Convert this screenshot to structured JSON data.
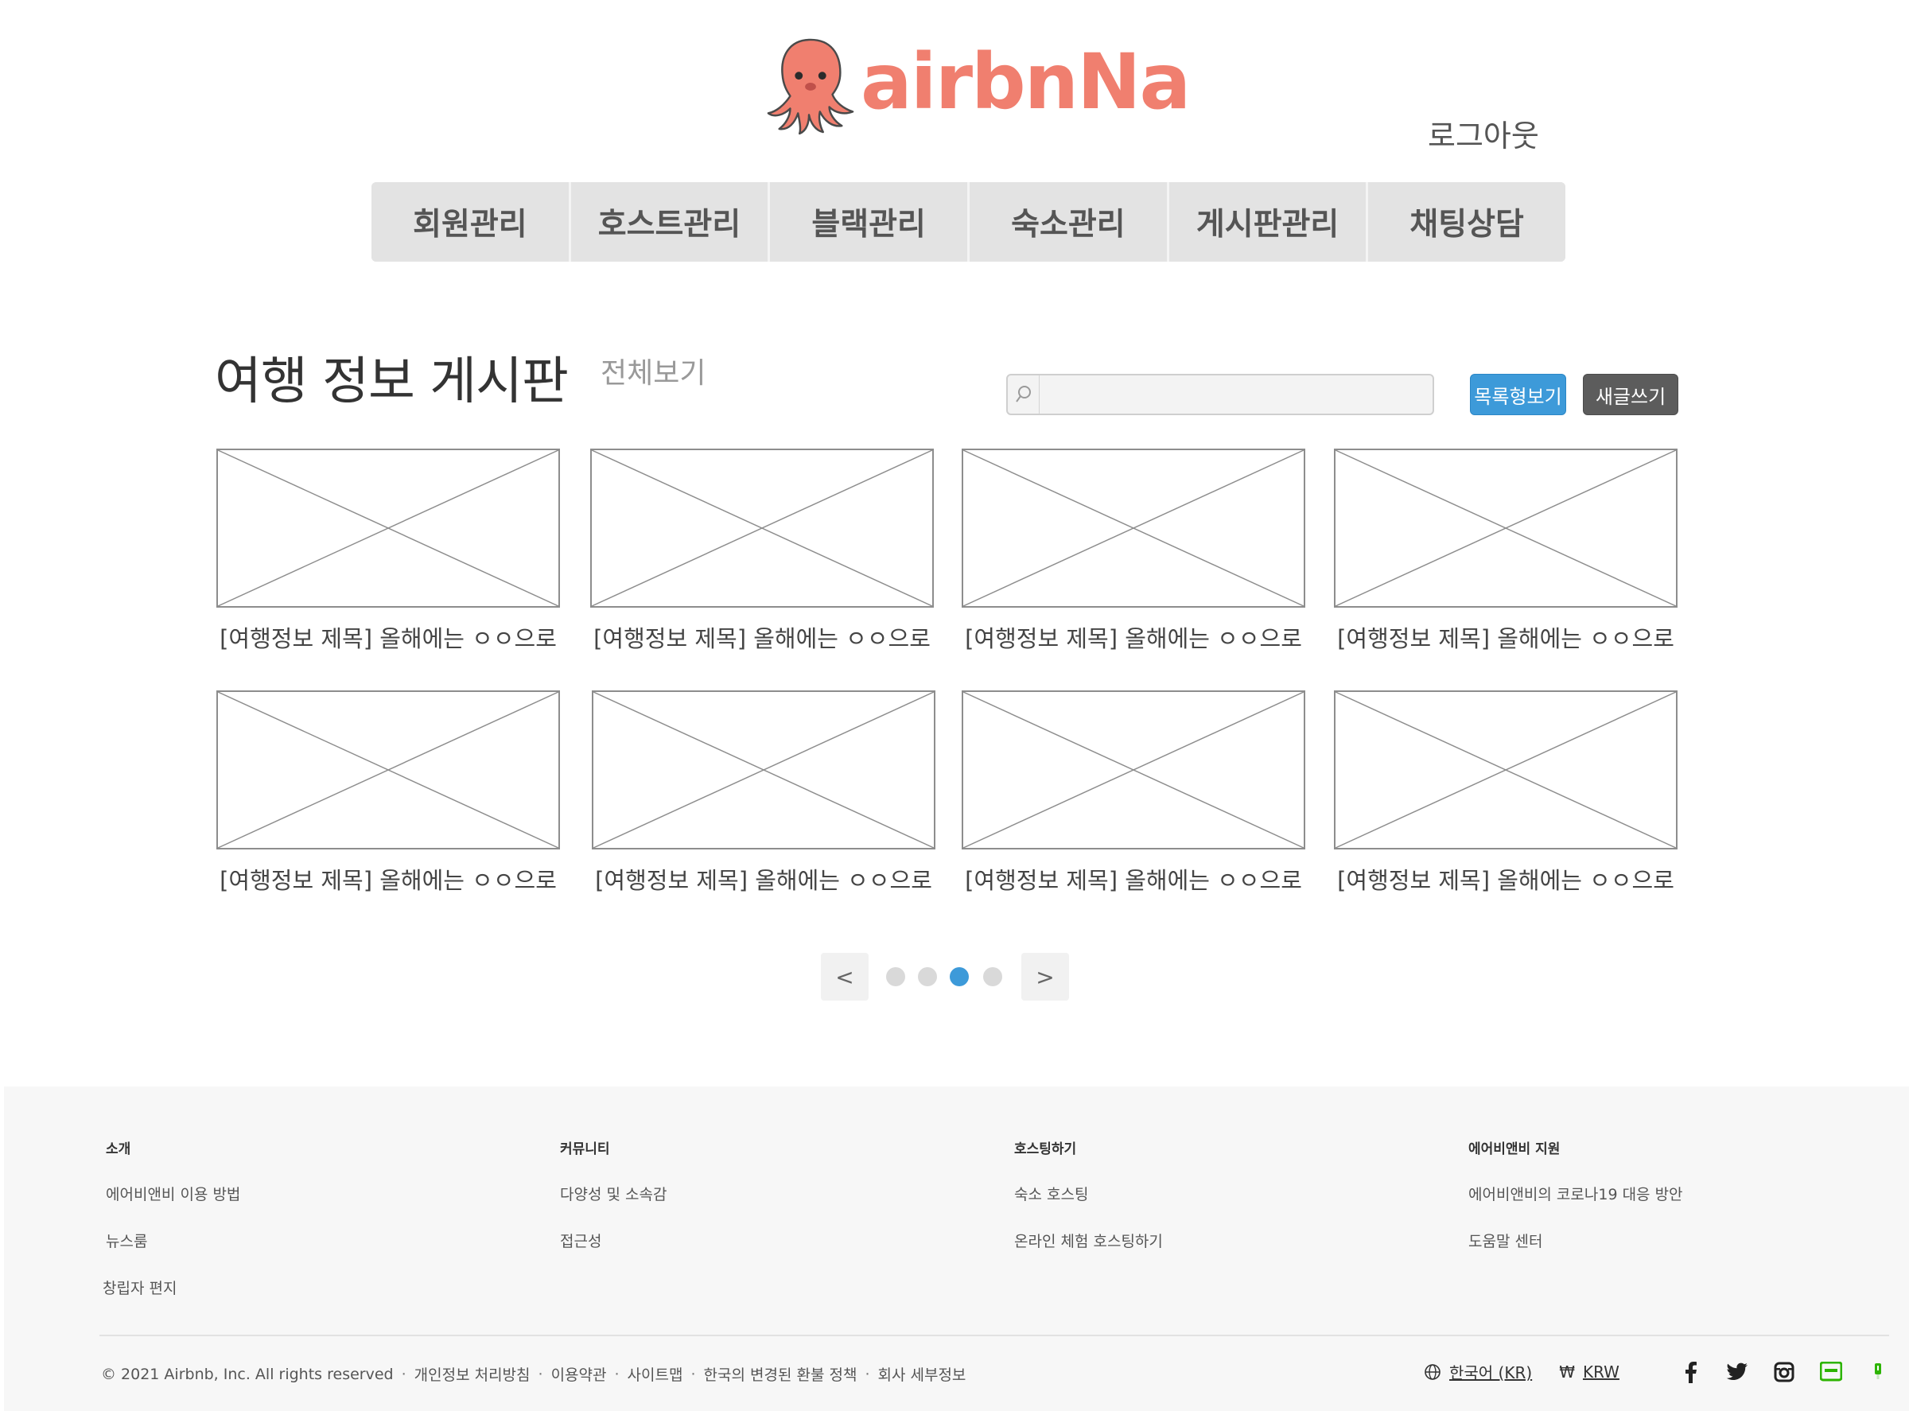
{
  "brand": {
    "name": "airbnNa",
    "color": "#f07f6f"
  },
  "header": {
    "logout_label": "로그아웃"
  },
  "nav": {
    "items": [
      "회원관리",
      "호스트관리",
      "블랙관리",
      "숙소관리",
      "게시판관리",
      "채팅상담"
    ]
  },
  "board": {
    "title": "여행 정보 게시판",
    "view_all": "전체보기",
    "search_placeholder": "",
    "list_view_label": "목록형보기",
    "write_label": "새글쓰기"
  },
  "cards": [
    {
      "caption": "[여행정보 제목] 올해에는 ㅇㅇ으로"
    },
    {
      "caption": "[여행정보 제목] 올해에는 ㅇㅇ으로"
    },
    {
      "caption": "[여행정보 제목] 올해에는 ㅇㅇ으로"
    },
    {
      "caption": "[여행정보 제목] 올해에는 ㅇㅇ으로"
    },
    {
      "caption": "[여행정보 제목] 올해에는 ㅇㅇ으로"
    },
    {
      "caption": "[여행정보 제목] 올해에는 ㅇㅇ으로"
    },
    {
      "caption": "[여행정보 제목] 올해에는 ㅇㅇ으로"
    },
    {
      "caption": "[여행정보 제목] 올해에는 ㅇㅇ으로"
    }
  ],
  "pagination": {
    "prev_label": "<",
    "next_label": ">",
    "page_count": 4,
    "current_page": 3,
    "active_color": "#3d9ad9"
  },
  "footer": {
    "columns": [
      {
        "heading": "소개",
        "links": [
          "에어비앤비 이용 방법",
          "뉴스룸",
          "창립자 편지"
        ]
      },
      {
        "heading": "커뮤니티",
        "links": [
          "다양성 및 소속감",
          "접근성"
        ]
      },
      {
        "heading": "호스팅하기",
        "links": [
          "숙소 호스팅",
          "온라인 체험 호스팅하기"
        ]
      },
      {
        "heading": "에어비앤비 지원",
        "links": [
          "에어비앤비의 코로나19 대응 방안",
          "도움말 센터"
        ]
      }
    ],
    "copyright": "© 2021 Airbnb, Inc. All rights reserved",
    "legal_links": [
      "개인정보 처리방침",
      "이용약관",
      "사이트맵",
      "한국의 변경된 환불 정책",
      "회사 세부정보"
    ],
    "language": "한국어 (KR)",
    "currency_symbol": "₩",
    "currency": "KRW",
    "social_icons": [
      "facebook-icon",
      "twitter-icon",
      "instagram-icon",
      "naver-blog-icon",
      "naver-post-icon"
    ]
  }
}
